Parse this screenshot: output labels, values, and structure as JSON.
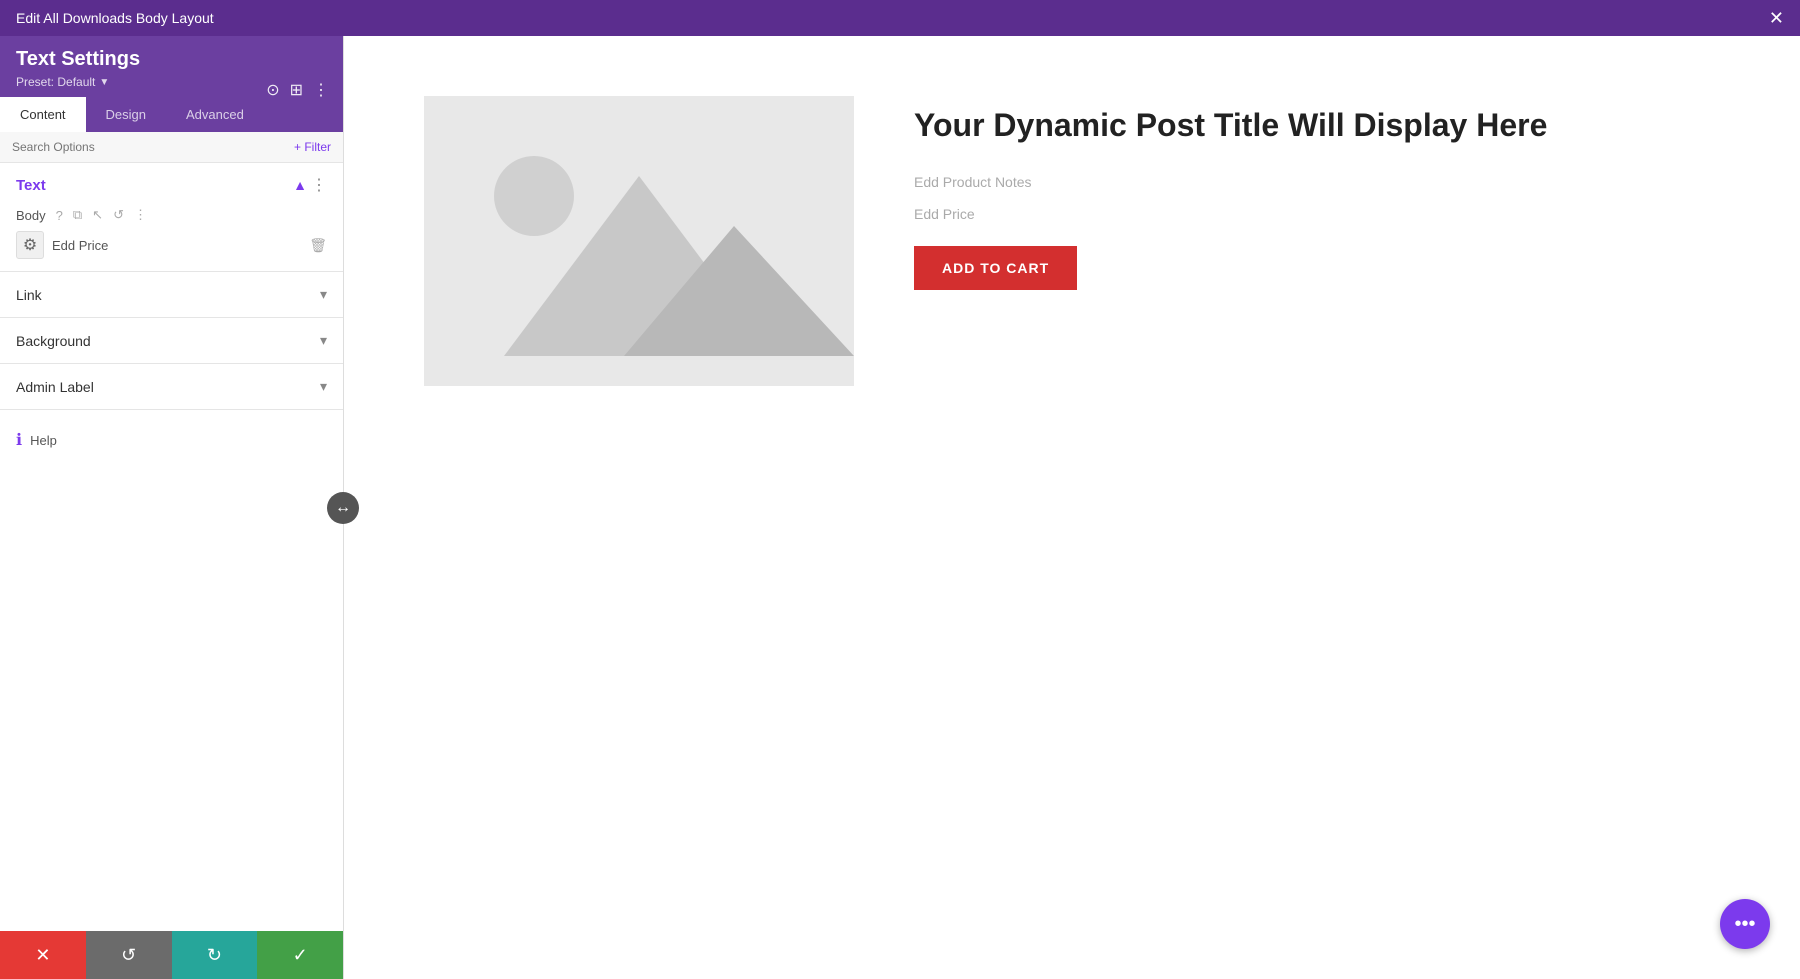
{
  "topbar": {
    "title": "Edit All Downloads Body Layout",
    "close_label": "✕"
  },
  "sidebar": {
    "settings_title": "Text Settings",
    "preset_label": "Preset: Default",
    "preset_arrow": "▼",
    "tabs": [
      {
        "id": "content",
        "label": "Content",
        "active": true
      },
      {
        "id": "design",
        "label": "Design",
        "active": false
      },
      {
        "id": "advanced",
        "label": "Advanced",
        "active": false
      }
    ],
    "search_placeholder": "Search Options",
    "filter_label": "+ Filter",
    "text_section": {
      "title": "Text",
      "body_label": "Body",
      "edd_price_label": "Edd Price"
    },
    "link_section": {
      "title": "Link"
    },
    "background_section": {
      "title": "Background"
    },
    "admin_label_section": {
      "title": "Admin Label"
    },
    "help_label": "Help"
  },
  "toolbar": {
    "cancel_icon": "✕",
    "undo_icon": "↺",
    "redo_icon": "↻",
    "confirm_icon": "✓"
  },
  "preview": {
    "product_title": "Your Dynamic Post Title Will Display Here",
    "product_notes": "Edd Product Notes",
    "product_price": "Edd Price",
    "add_to_cart_label": "ADD TO CART"
  },
  "floating_btn": {
    "label": "•••"
  }
}
